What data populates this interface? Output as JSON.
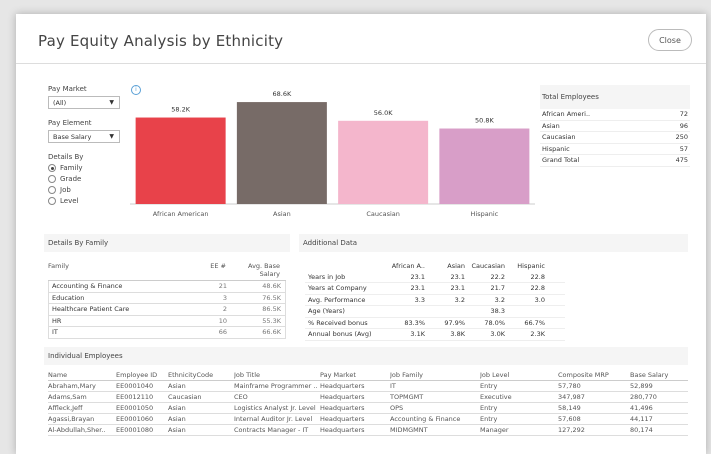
{
  "title": "Pay Equity Analysis by Ethnicity",
  "close_label": "Close",
  "filters": {
    "pay_market_label": "Pay Market",
    "pay_market_value": "(All)",
    "pay_element_label": "Pay Element",
    "pay_element_value": "Base Salary",
    "details_by_label": "Details By",
    "options": [
      "Family",
      "Grade",
      "Job",
      "Level"
    ],
    "selected": "Family"
  },
  "chart_data": {
    "type": "bar",
    "categories": [
      "African American",
      "Asian",
      "Caucasian",
      "Hispanic"
    ],
    "values": [
      58.2,
      68.6,
      56.0,
      50.8
    ],
    "data_labels": [
      "58.2K",
      "68.6K",
      "56.0K",
      "50.8K"
    ],
    "colors": [
      "#e8424a",
      "#776b67",
      "#f4b6cc",
      "#d89ec8"
    ],
    "ylim": [
      0,
      70
    ],
    "grid": false
  },
  "total_employees": {
    "title": "Total Employees",
    "rows": [
      {
        "label": "African Ameri..",
        "value": "72"
      },
      {
        "label": "Asian",
        "value": "96"
      },
      {
        "label": "Caucasian",
        "value": "250"
      },
      {
        "label": "Hispanic",
        "value": "57"
      },
      {
        "label": "Grand Total",
        "value": "475"
      }
    ]
  },
  "family_panel": {
    "title": "Details By Family",
    "headers": [
      "Family",
      "EE #",
      "Avg. Base Salary"
    ],
    "rows": [
      [
        "Accounting & Finance",
        "21",
        "48.6K"
      ],
      [
        "Education",
        "3",
        "76.5K"
      ],
      [
        "Healthcare Patient Care",
        "2",
        "86.5K"
      ],
      [
        "HR",
        "10",
        "55.3K"
      ],
      [
        "IT",
        "66",
        "66.6K"
      ]
    ]
  },
  "additional_panel": {
    "title": "Additional Data",
    "headers": [
      "",
      "African A..",
      "Asian",
      "Caucasian",
      "Hispanic"
    ],
    "rows": [
      [
        "Years in Job",
        "23.1",
        "23.1",
        "22.2",
        "22.8"
      ],
      [
        "Years at Company",
        "23.1",
        "23.1",
        "21.7",
        "22.8"
      ],
      [
        "Avg. Performance",
        "3.3",
        "3.2",
        "3.2",
        "3.0"
      ],
      [
        "Age (Years)",
        "",
        "",
        "38.3",
        ""
      ],
      [
        "% Received bonus",
        "83.3%",
        "97.9%",
        "78.0%",
        "66.7%"
      ],
      [
        "Annual bonus (Avg)",
        "3.1K",
        "3.8K",
        "3.0K",
        "2.3K"
      ]
    ]
  },
  "employees_panel": {
    "title": "Individual Employees",
    "headers": [
      "Name",
      "Employee ID",
      "EthnicityCode",
      "Job Title",
      "Pay Market",
      "Job Family",
      "Job Level",
      "Composite MRP",
      "Base Salary"
    ],
    "rows": [
      [
        "Abraham,Mary",
        "EE0001040",
        "Asian",
        "Mainframe Programmer ..",
        "Headquarters",
        "IT",
        "Entry",
        "57,780",
        "52,899"
      ],
      [
        "Adams,Sam",
        "EE0012110",
        "Caucasian",
        "CEO",
        "Headquarters",
        "TOPMGMT",
        "Executive",
        "347,987",
        "280,770"
      ],
      [
        "Affleck,Jeff",
        "EE0001050",
        "Asian",
        "Logistics Analyst Jr. Level",
        "Headquarters",
        "OPS",
        "Entry",
        "58,149",
        "41,496"
      ],
      [
        "Agassi,Brayan",
        "EE0001060",
        "Asian",
        "Internal Auditor Jr. Level",
        "Headquarters",
        "Accounting & Finance",
        "Entry",
        "57,608",
        "44,117"
      ],
      [
        "Al-Abdullah,Sher..",
        "EE0001080",
        "Asian",
        "Contracts Manager - IT",
        "Headquarters",
        "MIDMGMNT",
        "Manager",
        "127,292",
        "80,174"
      ]
    ]
  }
}
